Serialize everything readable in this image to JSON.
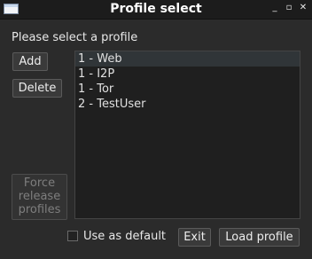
{
  "window": {
    "title": "Profile select",
    "controls": {
      "minimize": "_",
      "maximize": "▫",
      "close": "✕"
    }
  },
  "prompt": "Please select a profile",
  "buttons": {
    "add": "Add",
    "delete": "Delete",
    "force_release": [
      "Force",
      "release",
      "profiles"
    ],
    "exit": "Exit",
    "load_profile": "Load profile"
  },
  "profiles": [
    "1 - Web",
    "1 - I2P",
    "1 - Tor",
    "2 - TestUser"
  ],
  "selected_profile": "1 - Web",
  "use_as_default": {
    "label": "Use as default",
    "checked": false
  }
}
